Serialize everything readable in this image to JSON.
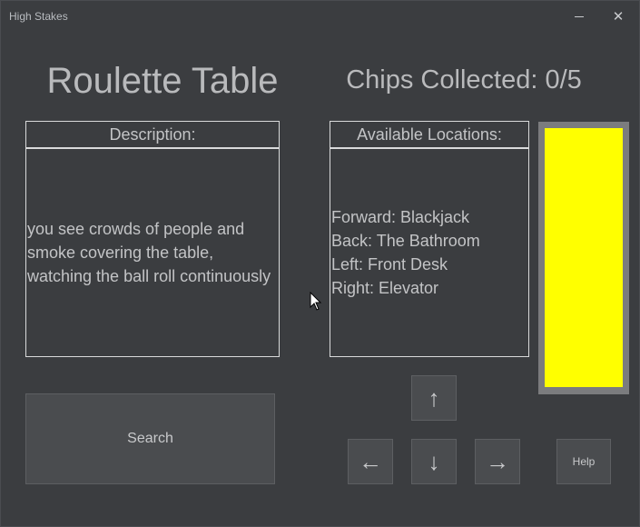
{
  "window": {
    "title": "High Stakes",
    "minimize_icon": "minimize-icon",
    "close_icon": "close-icon",
    "close_glyph": "✕"
  },
  "location": {
    "name": "Roulette Table"
  },
  "chips": {
    "label": "Chips Collected: 0/5",
    "collected": 0,
    "total": 5
  },
  "description": {
    "header": "Description:",
    "text": "you see crowds of people and smoke covering the table, watching the ball roll continuously"
  },
  "locations": {
    "header": "Available Locations:",
    "items": [
      "Forward: Blackjack",
      "Back: The Bathroom",
      "Left: Front Desk",
      "Right: Elevator"
    ]
  },
  "chip_indicator": {
    "color": "#ffff00",
    "frame_color": "#7b7c7e"
  },
  "buttons": {
    "search": "Search",
    "up": "↑",
    "left": "←",
    "down": "↓",
    "right": "→",
    "help": "Help"
  },
  "icons": {
    "cursor": "mouse-pointer-icon"
  }
}
